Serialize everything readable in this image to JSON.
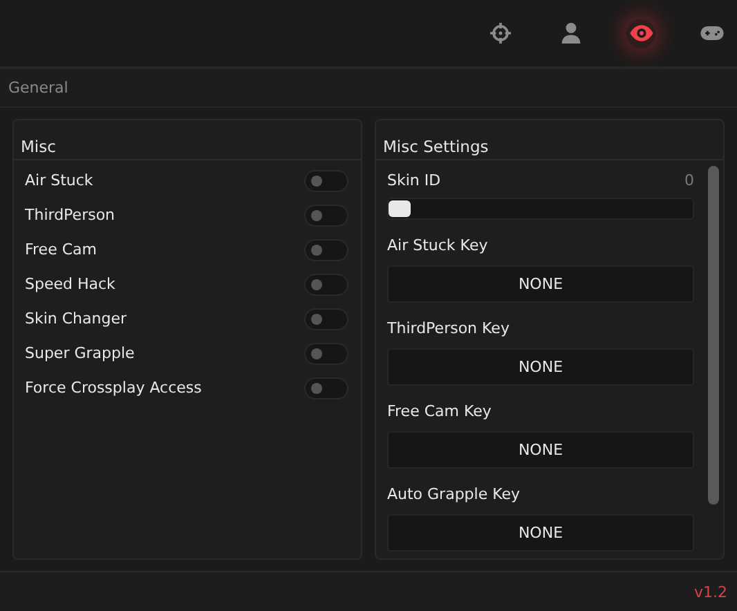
{
  "tabs": [
    {
      "kind": "crosshair",
      "selected": false
    },
    {
      "kind": "person",
      "selected": false
    },
    {
      "kind": "eye",
      "selected": true
    },
    {
      "kind": "gamepad",
      "selected": false
    }
  ],
  "section_title": "General",
  "misc": {
    "title": "Misc",
    "toggles": [
      {
        "label": "Air Stuck",
        "on": false
      },
      {
        "label": "ThirdPerson",
        "on": false
      },
      {
        "label": "Free Cam",
        "on": false
      },
      {
        "label": "Speed Hack",
        "on": false
      },
      {
        "label": "Skin Changer",
        "on": false
      },
      {
        "label": "Super Grapple",
        "on": false
      },
      {
        "label": "Force Crossplay Access",
        "on": false
      }
    ]
  },
  "misc_settings": {
    "title": "Misc Settings",
    "items": [
      {
        "kind": "slider",
        "label": "Skin ID",
        "reading": "0",
        "level": 0
      },
      {
        "kind": "key",
        "label": "Air Stuck Key",
        "value": "NONE"
      },
      {
        "kind": "key",
        "label": "ThirdPerson Key",
        "value": "NONE"
      },
      {
        "kind": "key",
        "label": "Free Cam Key",
        "value": "NONE"
      },
      {
        "kind": "key",
        "label": "Auto Grapple Key",
        "value": "NONE"
      }
    ]
  },
  "version": "v1.2"
}
